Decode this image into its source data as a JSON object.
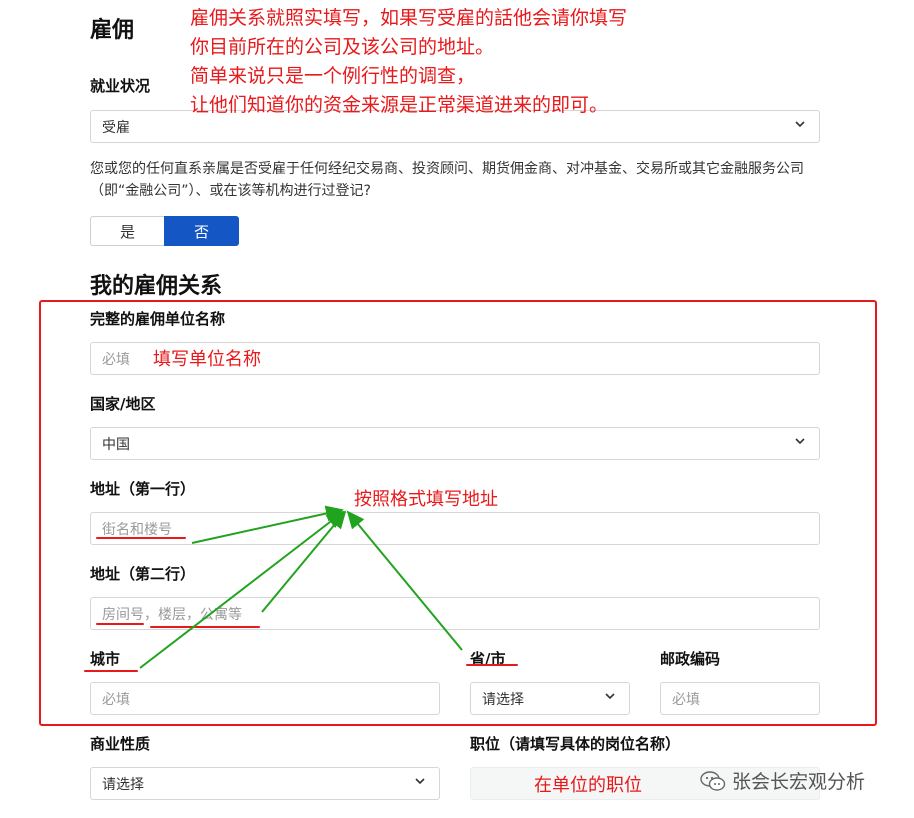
{
  "section1": {
    "title": "雇佣",
    "employment_label": "就业状况",
    "employment_value": "受雇",
    "affiliation_question": "您或您的任何直系亲属是否受雇于任何经纪交易商、投资顾问、期货佣金商、对冲基金、交易所或其它金融服务公司（即“金融公司”）、或在该等机构进行过登记?",
    "yes_label": "是",
    "no_label": "否",
    "selected": "否"
  },
  "section2": {
    "title": "我的雇佣关系",
    "company_label": "完整的雇佣单位名称",
    "company_placeholder": "必填",
    "country_label": "国家/地区",
    "country_value": "中国",
    "address1_label": "地址（第一行）",
    "address1_placeholder": "街名和楼号",
    "address2_label": "地址（第二行）",
    "address2_placeholder": "房间号，楼层，公寓等",
    "city_label": "城市",
    "city_placeholder": "必填",
    "province_label": "省/市",
    "province_value": "请选择",
    "postal_label": "邮政编码",
    "postal_placeholder": "必填",
    "business_label": "商业性质",
    "business_value": "请选择",
    "position_label": "职位（请填写具体的岗位名称）"
  },
  "annotations": {
    "top_note": [
      "雇佣关系就照实填写，如果写受雇的話他会请你填写",
      "你目前所在的公司及该公司的地址。",
      "简单来说只是一个例行性的调查，",
      "让他们知道你的资金来源是正常渠道进来的即可。"
    ],
    "company_note": "填写单位名称",
    "address_note": "按照格式填写地址",
    "position_note": "在单位的职位"
  },
  "watermark": "张会长宏观分析",
  "colors": {
    "primary": "#1456c4",
    "annotation": "#e8191b",
    "arrow": "#22a31f"
  }
}
